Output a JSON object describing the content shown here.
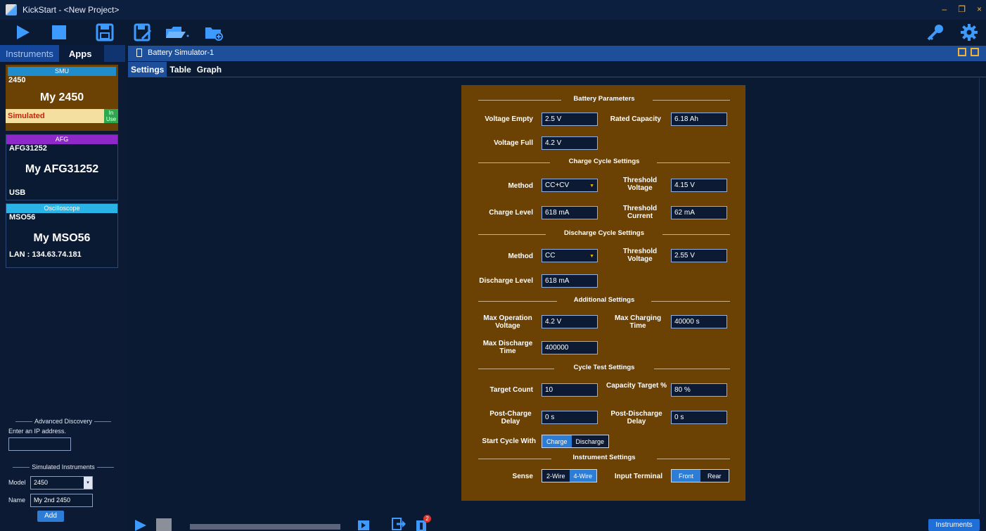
{
  "window": {
    "title": "KickStart - <New Project>"
  },
  "left_tabs": {
    "instruments": "Instruments",
    "apps": "Apps"
  },
  "instruments": [
    {
      "type": "SMU",
      "model": "2450",
      "name": "My 2450",
      "status": "Simulated",
      "in_use": "In Use",
      "header_color": "#1f8dcc"
    },
    {
      "type": "AFG",
      "model": "AFG31252",
      "name": "My AFG31252",
      "connection": "USB",
      "header_color": "#8e28c8"
    },
    {
      "type": "Oscilloscope",
      "model": "MSO56",
      "name": "My MSO56",
      "connection": "LAN : 134.63.74.181",
      "header_color": "#2ab3e6"
    }
  ],
  "advanced_discovery": {
    "title": "Advanced Discovery",
    "hint": "Enter an IP address.",
    "ip_value": ""
  },
  "simulated": {
    "title": "Simulated Instruments",
    "model_label": "Model",
    "model_value": "2450",
    "name_label": "Name",
    "name_value": "My 2nd 2450",
    "add_label": "Add"
  },
  "document": {
    "title": "Battery Simulator-1"
  },
  "sub_tabs": [
    "Settings",
    "Table",
    "Graph"
  ],
  "form": {
    "battery": {
      "section": "Battery Parameters",
      "voltage_empty_label": "Voltage Empty",
      "voltage_empty": "2.5 V",
      "rated_capacity_label": "Rated Capacity",
      "rated_capacity": "6.18 Ah",
      "voltage_full_label": "Voltage Full",
      "voltage_full": "4.2 V"
    },
    "charge": {
      "section": "Charge Cycle Settings",
      "method_label": "Method",
      "method": "CC+CV",
      "threshold_voltage_label": "Threshold Voltage",
      "threshold_voltage": "4.15 V",
      "charge_level_label": "Charge Level",
      "charge_level": "618 mA",
      "threshold_current_label": "Threshold Current",
      "threshold_current": "62 mA"
    },
    "discharge": {
      "section": "Discharge Cycle Settings",
      "method_label": "Method",
      "method": "CC",
      "threshold_voltage_label": "Threshold Voltage",
      "threshold_voltage": "2.55 V",
      "discharge_level_label": "Discharge Level",
      "discharge_level": "618 mA"
    },
    "additional": {
      "section": "Additional Settings",
      "max_op_voltage_label": "Max Operation Voltage",
      "max_op_voltage": "4.2 V",
      "max_charging_time_label": "Max Charging Time",
      "max_charging_time": "40000 s",
      "max_discharge_time_label": "Max Discharge Time",
      "max_discharge_time": "400000"
    },
    "cycle": {
      "section": "Cycle Test Settings",
      "target_count_label": "Target Count",
      "target_count": "10",
      "capacity_target_label": "Capacity Target %",
      "capacity_target": "80 %",
      "post_charge_label": "Post-Charge Delay",
      "post_charge": "0 s",
      "post_discharge_label": "Post-Discharge Delay",
      "post_discharge": "0 s",
      "start_with_label": "Start Cycle With",
      "start_charge": "Charge",
      "start_discharge": "Discharge"
    },
    "instrument": {
      "section": "Instrument Settings",
      "sense_label": "Sense",
      "sense_2wire": "2-Wire",
      "sense_4wire": "4-Wire",
      "terminal_label": "Input Terminal",
      "terminal_front": "Front",
      "terminal_rear": "Rear"
    }
  },
  "bottom": {
    "instruments_button": "Instruments",
    "notification_count": "2"
  },
  "colors": {
    "accent": "#2d7cd6",
    "panel": "#6b4104",
    "background": "#0b1a33",
    "icon_blue": "#3d9bff"
  }
}
